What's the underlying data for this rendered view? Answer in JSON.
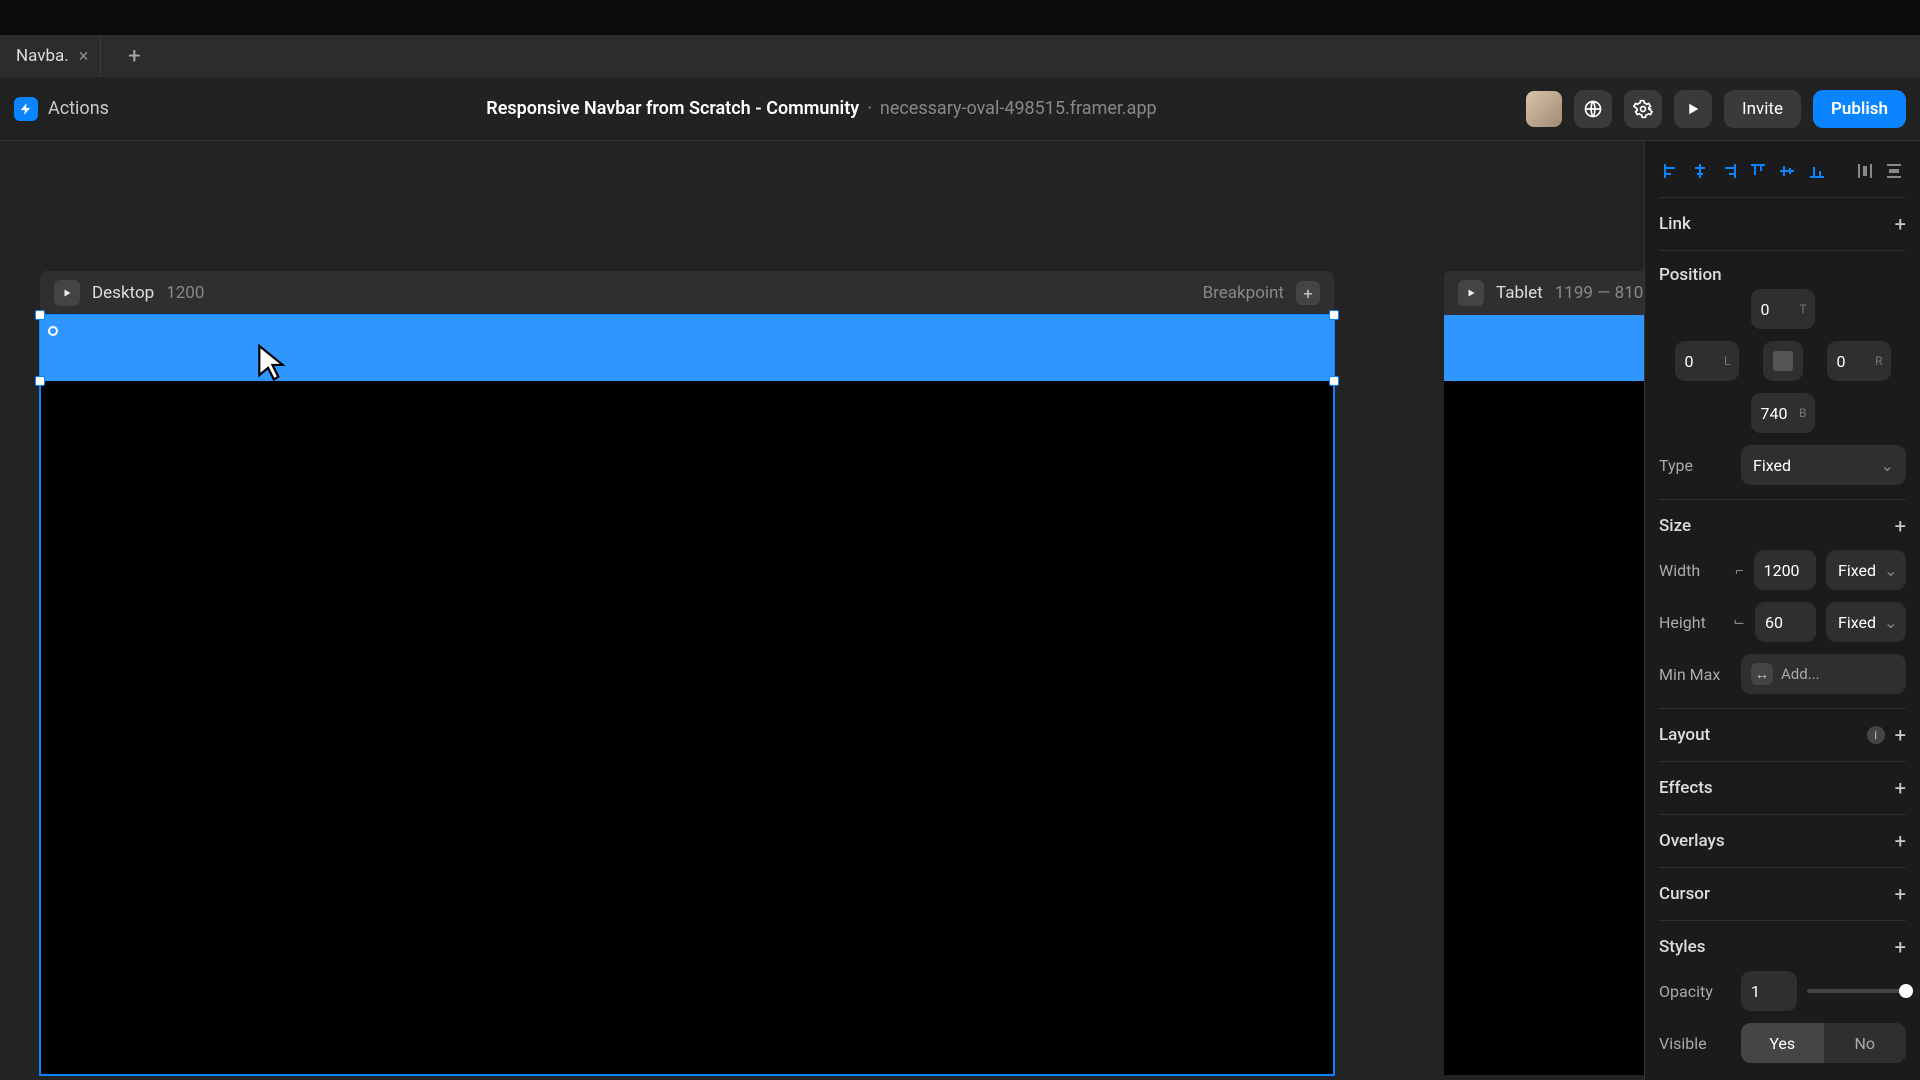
{
  "tabs": {
    "active_label": "Navba."
  },
  "topbar": {
    "actions_label": "Actions",
    "title_main": "Responsive Navbar from Scratch - Community",
    "title_sub": "necessary-oval-498515.framer.app",
    "invite_label": "Invite",
    "publish_label": "Publish"
  },
  "canvas": {
    "desktop": {
      "name": "Desktop",
      "dim": "1200",
      "breakpoint_label": "Breakpoint"
    },
    "tablet": {
      "name": "Tablet",
      "dim": "1199 — 810"
    }
  },
  "inspector": {
    "link_title": "Link",
    "position_title": "Position",
    "pos": {
      "t": "0",
      "l": "0",
      "r": "0",
      "b": "740",
      "t_suf": "T",
      "l_suf": "L",
      "r_suf": "R",
      "b_suf": "B"
    },
    "position_type_label": "Type",
    "position_type_value": "Fixed",
    "size_title": "Size",
    "width_label": "Width",
    "width_value": "1200",
    "width_mode": "Fixed",
    "height_label": "Height",
    "height_value": "60",
    "height_mode": "Fixed",
    "minmax_label": "Min Max",
    "minmax_placeholder": "Add...",
    "layout_title": "Layout",
    "effects_title": "Effects",
    "overlays_title": "Overlays",
    "cursor_title": "Cursor",
    "styles_title": "Styles",
    "opacity_label": "Opacity",
    "opacity_value": "1",
    "visible_label": "Visible",
    "visible_yes": "Yes",
    "visible_no": "No"
  }
}
